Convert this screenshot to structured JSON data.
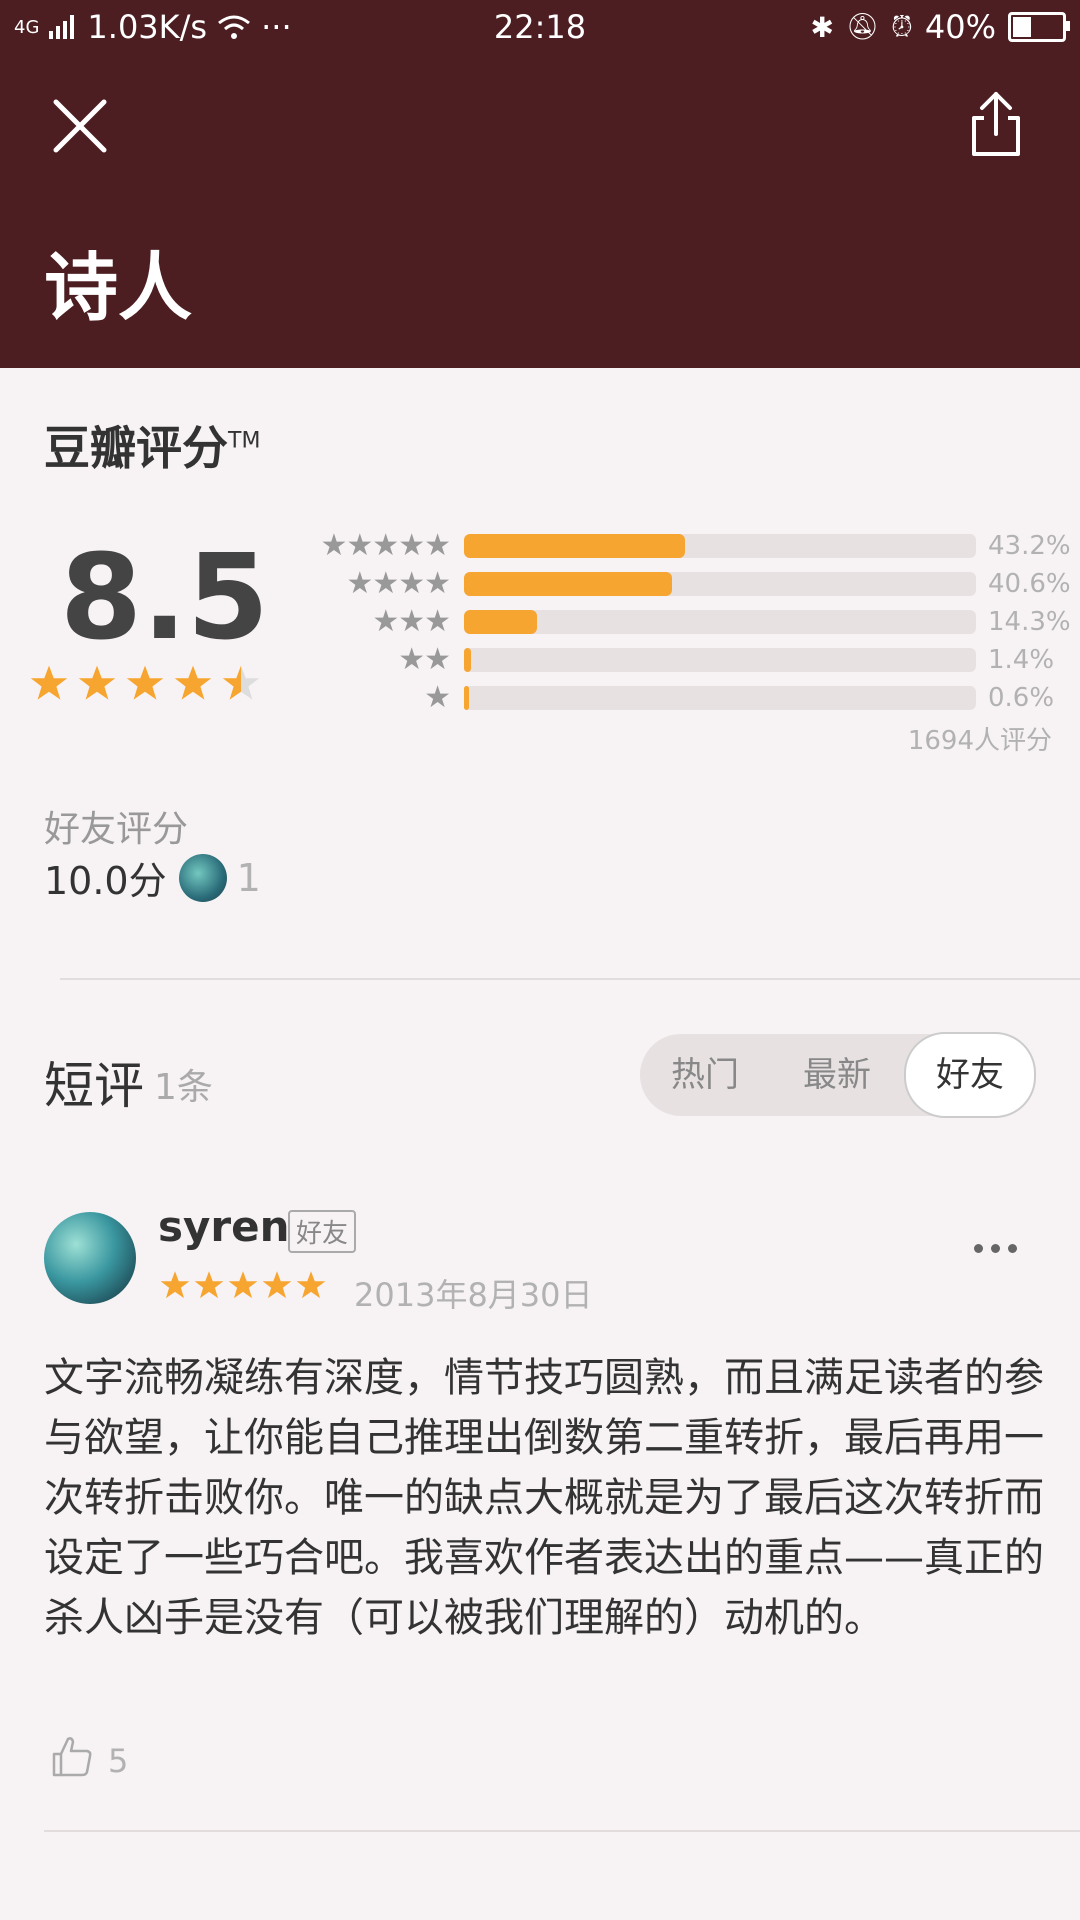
{
  "status_bar": {
    "network": "4G",
    "speed": "1.03K/s",
    "more": "···",
    "time": "22:18",
    "battery": "40%"
  },
  "header": {
    "title": "诗人"
  },
  "rating": {
    "section_title": "豆瓣评分",
    "trademark": "TM",
    "score": "8.5",
    "star_rating": 4.5,
    "distribution": [
      {
        "stars": "★★★★★",
        "percent_label": "43.2%",
        "percent": 43.2
      },
      {
        "stars": "★★★★",
        "percent_label": "40.6%",
        "percent": 40.6
      },
      {
        "stars": "★★★",
        "percent_label": "14.3%",
        "percent": 14.3
      },
      {
        "stars": "★★",
        "percent_label": "1.4%",
        "percent": 1.4
      },
      {
        "stars": "★",
        "percent_label": "0.6%",
        "percent": 0.6
      }
    ],
    "count": "1694人评分"
  },
  "friends": {
    "label": "好友评分",
    "score": "10.0分",
    "count": "1"
  },
  "short_reviews": {
    "title": "短评",
    "count": "1条",
    "tabs": [
      "热门",
      "最新",
      "好友"
    ],
    "active_tab": "好友"
  },
  "review": {
    "username": "syren",
    "badge": "好友",
    "star_rating": 5,
    "date": "2013年8月30日",
    "text": "文字流畅凝练有深度，情节技巧圆熟，而且满足读者的参与欲望，让你能自己推理出倒数第二重转折，最后再用一次转折击败你。唯一的缺点大概就是为了最后这次转折而设定了一些巧合吧。我喜欢作者表达出的重点——真正的杀人凶手是没有（可以被我们理解的）动机的。",
    "likes": "5"
  },
  "colors": {
    "header_bg": "#4c1e22",
    "bar_fill": "#f7a531",
    "star": "#f7a531"
  }
}
